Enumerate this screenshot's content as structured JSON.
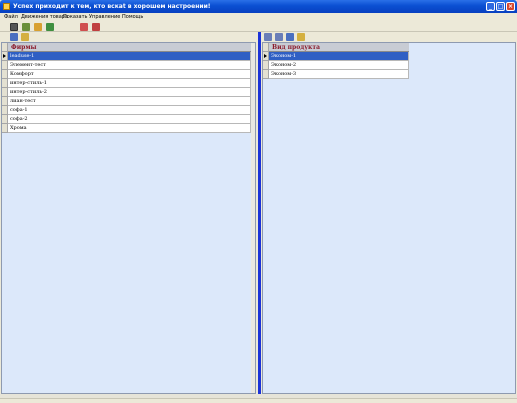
{
  "window": {
    "title": "Успех приходит к тем, кто вскаt в хорошем настроении!",
    "controls": [
      "_",
      "□",
      "×"
    ]
  },
  "menu": [
    "Файл",
    "Движения товара",
    "Показать",
    "Управление",
    "Помощь"
  ],
  "toolbar": {
    "icons": [
      "folder-icon",
      "table-icon",
      "person-icon",
      "leaf-icon",
      "text-a-icon",
      "text-b-icon"
    ]
  },
  "left_pane": {
    "toolbar_icons": [
      "copy-icon",
      "pencil-icon"
    ],
    "column_header": "Фирмы",
    "rows": [
      "leaduse-1",
      "Элемент-тест",
      "Комфорт",
      "интер-стиль-1",
      "интер-стиль-2",
      "лиан-тест",
      "софа-1",
      "софа-2",
      "Хрома"
    ],
    "selected_index": 0
  },
  "right_pane": {
    "toolbar_icons": [
      "nav-left-icon",
      "nav-right-icon",
      "copy-icon",
      "pencil-icon"
    ],
    "column_header": "Вид продукта",
    "rows": [
      "Эконом-1",
      "Эконом-2",
      "Эконом-3"
    ],
    "selected_index": 0
  },
  "colors": {
    "titlebar": "#0A4FD2",
    "grid_bg": "#DCE8FA",
    "selected_row": "#2F5FC4",
    "header_text": "#8B1A2B",
    "splitter": "#1C33D8"
  }
}
